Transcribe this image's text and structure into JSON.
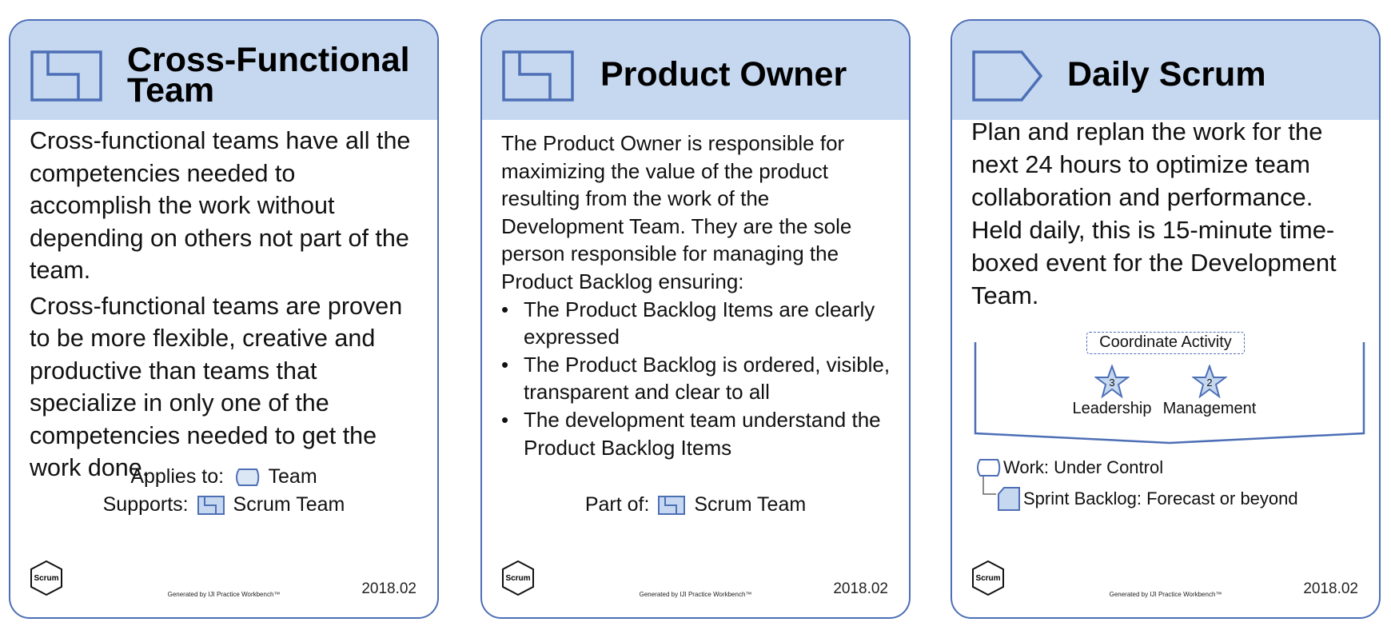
{
  "cards": [
    {
      "title_line1": "Cross-Functional",
      "title_line2": "Team",
      "paragraphs": [
        "Cross-functional teams have all the competencies needed to accomplish the work without depending on others not part of the team.",
        "Cross-functional teams are proven to be more flexible, creative and productive than teams that specialize in only one of the competencies needed to get the work done."
      ],
      "applies_label": "Applies to:",
      "applies_value": "Team",
      "supports_label": "Supports:",
      "supports_value": "Scrum Team",
      "badge": "Scrum",
      "generated": "Generated by IJI Practice Workbench™",
      "version": "2018.02"
    },
    {
      "title": "Product Owner",
      "intro": "The Product Owner is responsible for maximizing the value of the product resulting from the work of the Development Team. They are the sole person responsible for managing the Product Backlog ensuring:",
      "bullets": [
        "The Product Backlog Items are clearly expressed",
        "The Product Backlog is ordered, visible, transparent and clear to all",
        "The development team understand the Product Backlog Items"
      ],
      "bullet_symbol": "•",
      "part_of_label": "Part of:",
      "part_of_value": "Scrum Team",
      "badge": "Scrum",
      "generated": "Generated by IJI Practice Workbench™",
      "version": "2018.02"
    },
    {
      "title": "Daily Scrum",
      "paragraphs": [
        "Plan and replan the work for the next 24 hours to optimize team collaboration and performance.",
        "Held daily, this is 15-minute time-boxed event for the Development Team."
      ],
      "activity_label": "Coordinate Activity",
      "competencies": [
        {
          "name": "Leadership",
          "level": "3"
        },
        {
          "name": "Management",
          "level": "2"
        }
      ],
      "work_line": "Work: Under Control",
      "backlog_line": "Sprint Backlog: Forecast or beyond",
      "badge": "Scrum",
      "generated": "Generated by IJI Practice Workbench™",
      "version": "2018.02"
    }
  ],
  "colors": {
    "border": "#4d6fb6",
    "header": "#c6d8f0",
    "icon_fill": "#c6d8f0"
  }
}
